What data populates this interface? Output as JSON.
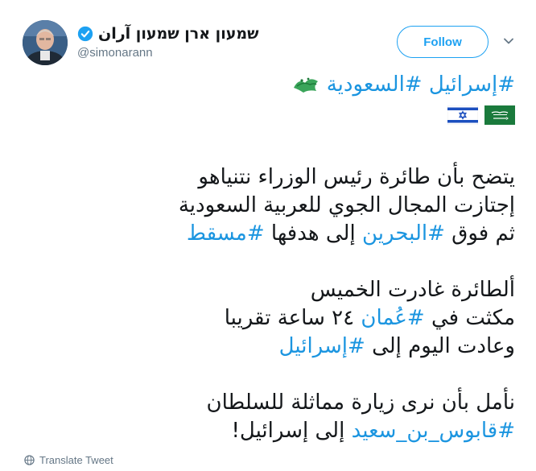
{
  "author": {
    "display_name": "שמעון ארן שמעון آران",
    "handle": "@simonarann",
    "verified": true
  },
  "follow_button": {
    "label": "Follow"
  },
  "tweet": {
    "hashtag_line": [
      "#إسرائيل",
      "#السعودية"
    ],
    "flags": [
      "saudi-arabia-flag",
      "israel-flag"
    ],
    "decorative_emoji": "green-calligraphy-emoji",
    "paragraph1": {
      "line1": "يتضح بأن طائرة رئيس الوزراء نتنياهو",
      "line2": "إجتازت المجال الجوي للعربية السعودية",
      "line3_prefix": "ثم فوق ",
      "line3_tag1": "#البحرين",
      "line3_mid": " إلى هدفها ",
      "line3_tag2": "#مسقط"
    },
    "paragraph2": {
      "line1": "ألطائرة غادرت الخميس",
      "line2_prefix": "مكثت في ",
      "line2_tag": "#عُمان",
      "line2_suffix": " ٢٤ ساعة تقريبا",
      "line3_prefix": "وعادت اليوم إلى ",
      "line3_tag": "#إسرائيل"
    },
    "paragraph3": {
      "line1": "نأمل بأن نرى زيارة مماثلة للسلطان",
      "line2_tag": "#قابوس_بن_سعيد",
      "line2_suffix": " إلى إسرائيل!"
    }
  },
  "translate": {
    "label": "Translate Tweet",
    "icon": "globe-icon"
  },
  "colors": {
    "link": "#1b95e0",
    "follow_border": "#1da1f2",
    "muted": "#657786",
    "text": "#14171a"
  }
}
